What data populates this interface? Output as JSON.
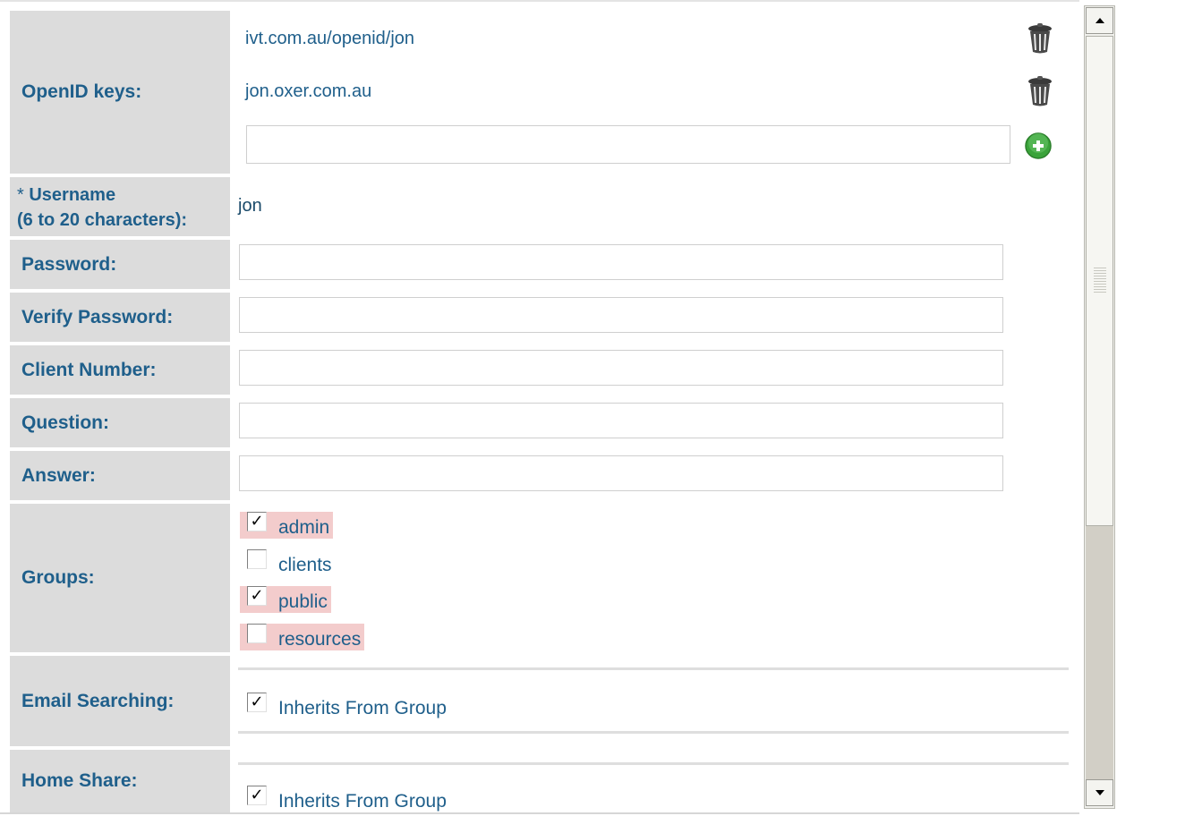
{
  "form": {
    "openid": {
      "label": "OpenID keys:",
      "keys": [
        "ivt.com.au/openid/jon",
        "jon.oxer.com.au"
      ],
      "new_key_value": "",
      "delete_icon": "trash-can-icon",
      "add_icon": "green-plus-circle-icon"
    },
    "username": {
      "required_marker": "*",
      "label_line1": "Username",
      "label_line2": "(6 to 20 characters):",
      "value": "jon"
    },
    "password": {
      "label": "Password:",
      "value": ""
    },
    "verify_password": {
      "label": "Verify Password:",
      "value": ""
    },
    "client_number": {
      "label": "Client Number:",
      "value": ""
    },
    "question": {
      "label": "Question:",
      "value": ""
    },
    "answer": {
      "label": "Answer:",
      "value": ""
    },
    "groups": {
      "label": "Groups:",
      "items": [
        {
          "name": "admin",
          "checked": true,
          "highlighted": true
        },
        {
          "name": "clients",
          "checked": false,
          "highlighted": false
        },
        {
          "name": "public",
          "checked": true,
          "highlighted": true
        },
        {
          "name": "resources",
          "checked": false,
          "highlighted": true
        }
      ],
      "highlight_color": "#f3cccc"
    },
    "email_searching": {
      "label": "Email Searching:",
      "checkbox_label": "Inherits From Group",
      "checked": true
    },
    "home_share": {
      "label": "Home Share:",
      "checkbox_label": "Inherits From Group",
      "checked": true
    }
  },
  "colors": {
    "label_bg": "#dcdcdc",
    "label_text": "#1f5f8b"
  },
  "scrollbar": {
    "up_icon": "arrow-up-icon",
    "down_icon": "arrow-down-icon"
  }
}
